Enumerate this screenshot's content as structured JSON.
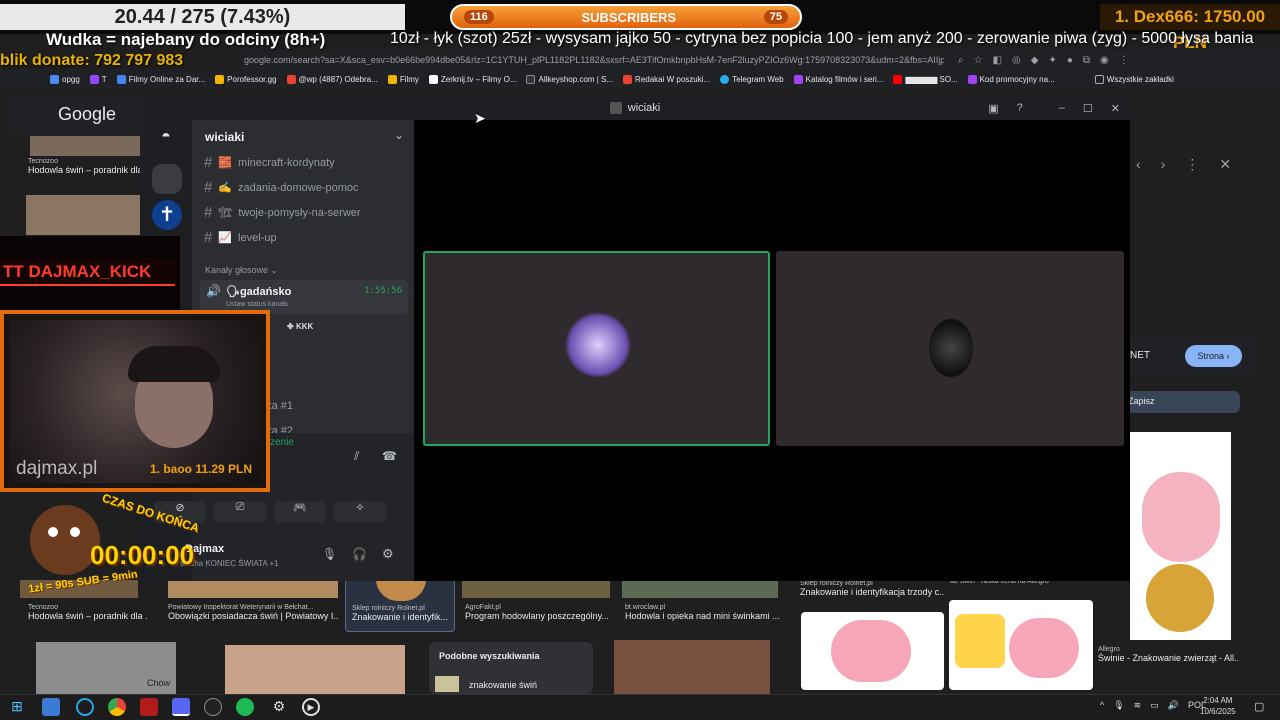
{
  "overlay": {
    "goal_text": "20.44 / 275 (7.43%)",
    "subs_left": "116",
    "subs_label": "SUBSCRIBERS",
    "subs_right": "75",
    "top_donor": "1. Dex666: 1750.00 PLN",
    "wudka": "Wudka = najebany do odciny (8h+)",
    "ticker": "10zł - łyk (szot) 25zł - wysysam jajko  50 - cytryna bez popicia 100 - jem anyż 200 - zerowanie piwa (zyg) -  5000 łysa bania",
    "blik": "blik donate: 792 797 983"
  },
  "browser": {
    "address": "google.com/search?sa=X&sca_esv=b0e66be994dbe05&rlz=1C1YTUH_plPL1182PL1182&sxsrf=AE3TifOmkbnpbHsM-7enF2luzyPZIOz6Wg:1759708323073&udm=2&fbs=AIIjpHwW-0r_Aj4Uyf..."
  },
  "bookmarks": [
    {
      "label": "opgg",
      "color": "#4c8bf5"
    },
    {
      "label": "T",
      "color": "#9147ff"
    },
    {
      "label": "Filmy Online za Dar...",
      "color": "#4285f4"
    },
    {
      "label": "Porofessor.gg",
      "color": "#f4b400"
    },
    {
      "label": "@wp (4887) Odebra...",
      "color": "#ea4335"
    },
    {
      "label": "Filmy",
      "color": "#f4b400"
    },
    {
      "label": "Zerknij.tv – Filmy O...",
      "color": "#ffffff"
    },
    {
      "label": "Allkeyshop.com | S...",
      "color": "#333333"
    },
    {
      "label": "Redakai W poszuki...",
      "color": "#ea4335"
    },
    {
      "label": "Telegram Web",
      "color": "#2aabee"
    },
    {
      "label": "Katalog filmów i seri...",
      "color": "#a142f4"
    },
    {
      "label": "SO...",
      "color": "#ff0000"
    },
    {
      "label": "Kod promocyjny na...",
      "color": "#a142f4"
    },
    {
      "label": "Wszystkie zakładki",
      "color": "#888888"
    }
  ],
  "google": {
    "logo": "Google",
    "left_items": [
      {
        "source": "Tecnozoo",
        "title": "Hodowla świń – poradnik dla"
      },
      {
        "source": "Tecnozoo",
        "title": "Hodowla świń – poradnik dla ..."
      }
    ],
    "bottom_items": [
      {
        "source": "Powiatowy Inspektorat Weterynarii w Bełchat...",
        "title": "Obowiązki posiadacza świń | Powiatowy I..."
      },
      {
        "source": "Sklep rolniczy Rolnet.pl",
        "title": "Znakowanie i identyfik..."
      },
      {
        "source": "AgroFakt.pl",
        "title": "Program hodowlany poszczególny..."
      },
      {
        "source": "bt.wroclaw.pl",
        "title": "Hodowla i opieka nad mini świnkami ..."
      },
      {
        "source": "Sklep rolniczy Rolnet.pl",
        "title": "Znakowanie i identyfikacja trzody c..."
      },
      {
        "source": "do Świń - Niska cena na Allegro",
        "title": ""
      }
    ],
    "right_items": [
      {
        "source": "Allegro",
        "title": "Świnie - Znakowanie zwierząt - All..."
      }
    ],
    "related_title": "Podobne wyszukiwania",
    "related_item": "znakowanie świń",
    "panel_pill": "Strona",
    "panel_text": "NET",
    "panel_save": "Zapisz",
    "chow": "Chow"
  },
  "discord": {
    "window_title": "wiciaki",
    "server_name": "wiciaki",
    "text_channels": [
      {
        "name": "minecraft-kordynaty",
        "emoji": "🧱"
      },
      {
        "name": "zadania-domowe-pomoc",
        "emoji": "✍"
      },
      {
        "name": "twoje-pomysły-na-serwer",
        "emoji": "🏗"
      },
      {
        "name": "level-up",
        "emoji": "📈"
      }
    ],
    "voice_header": "Kanały głosowe",
    "voice_channel": "🗣gadańsko",
    "voice_timer": "1:55:56",
    "voice_status": "Ustaw status kanału",
    "member_tag": "KKK",
    "partial_1": "dka #1",
    "partial_2": "dka #2",
    "connection": "zenie",
    "user_name": "Dajmax",
    "user_status": "słucha KONIEC ŚWIATA +1"
  },
  "webcam": {
    "tt_label": "TT DAJMAX_KICK",
    "watermark": "dajmax.pl",
    "cam_donor": "1. baoo 11.29 PLN",
    "timer_label": "CZAS DO KOŃCA",
    "timer": "00:00:00",
    "timer_foot": "1zł = 90s  SUB = 9min"
  },
  "taskbar": {
    "lang": "POL",
    "time": "2:04 AM",
    "date": "10/6/2025"
  },
  "colors": {
    "accent_orange": "#e36b0b",
    "discord_green": "#23a55a",
    "gold": "#f2a10f"
  }
}
